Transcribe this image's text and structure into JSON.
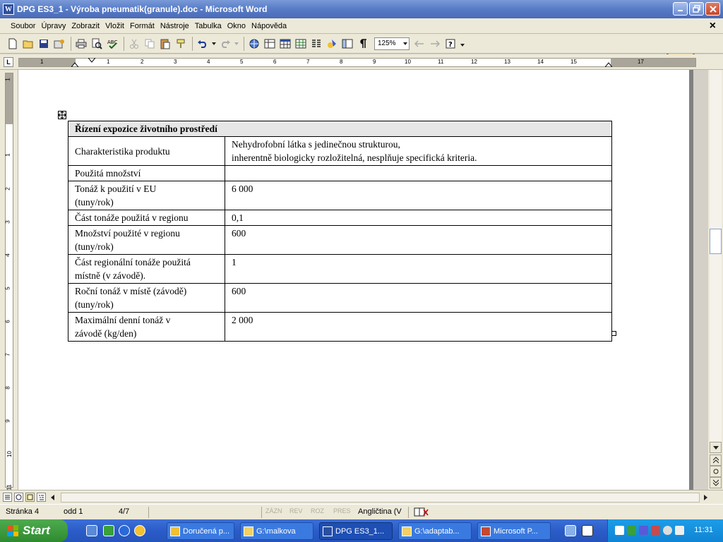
{
  "window": {
    "title": "DPG ES3_1 - Výroba pneumatik(granule).doc - Microsoft Word",
    "icon_letter": "W"
  },
  "menu": {
    "items": [
      {
        "label": "Soubor"
      },
      {
        "label": "Úpravy"
      },
      {
        "label": "Zobrazit"
      },
      {
        "label": "Vložit"
      },
      {
        "label": "Formát"
      },
      {
        "label": "Nástroje"
      },
      {
        "label": "Tabulka"
      },
      {
        "label": "Okno"
      },
      {
        "label": "Nápověda"
      }
    ],
    "close_glyph": "×"
  },
  "toolbar": {
    "zoom": "125%"
  },
  "ruler": {
    "corner": "L",
    "numbers": [
      "1",
      "1",
      "2",
      "3",
      "4",
      "5",
      "6",
      "7",
      "8",
      "9",
      "10",
      "11",
      "12",
      "13",
      "14",
      "15",
      "17"
    ],
    "vnumbers": [
      "1",
      "1",
      "2",
      "3",
      "4",
      "5",
      "6",
      "7",
      "8",
      "9",
      "10",
      "11"
    ]
  },
  "table": {
    "header": "Řízení expozice životního prostředí",
    "rows": [
      {
        "label": "Charakteristika produktu",
        "value_lines": [
          "Nehydrofobní látka s jedinečnou strukturou,",
          "inherentně biologicky rozložitelná, nesplňuje specifická kriteria."
        ]
      },
      {
        "label": "Použitá množství",
        "value_lines": [
          ""
        ]
      },
      {
        "label_lines": [
          "Tonáž k použití v EU",
          "(tuny/rok)"
        ],
        "value_lines": [
          "6 000"
        ]
      },
      {
        "label": "Část tonáže použitá v regionu",
        "value_lines": [
          "0,1"
        ]
      },
      {
        "label_lines": [
          "Množství použité v regionu",
          "(tuny/rok)"
        ],
        "value_lines": [
          "600"
        ]
      },
      {
        "label_lines": [
          "Část regionální tonáže použitá",
          "místně (v závodě)."
        ],
        "value_lines": [
          "1"
        ]
      },
      {
        "label_lines": [
          "Roční tonáž v místě (závodě)",
          "(tuny/rok)"
        ],
        "value_lines": [
          "600"
        ]
      },
      {
        "label_lines": [
          "Maximální denní tonáž v",
          "závodě (kg/den)"
        ],
        "value_lines": [
          "2 000"
        ]
      }
    ]
  },
  "status": {
    "page": "Stránka 4",
    "section": "odd 1",
    "pages": "4/7",
    "rec": "ZÁZN",
    "rev": "REV",
    "ext": "ROZ",
    "ovr": "PRES",
    "language": "Angličtina (V"
  },
  "taskbar": {
    "start": "Start",
    "tasks": [
      {
        "label": "Doručená p..."
      },
      {
        "label": "G:\\malkova"
      },
      {
        "label": "DPG ES3_1..."
      },
      {
        "label": "G:\\adaptab..."
      },
      {
        "label": "Microsoft P..."
      }
    ],
    "clock": "11:31"
  },
  "colors": {
    "titlebar": "#5a7ec8",
    "taskbar": "#2b5cc8",
    "start": "#3a9a3a",
    "table_header_bg": "#e6e6e6"
  }
}
